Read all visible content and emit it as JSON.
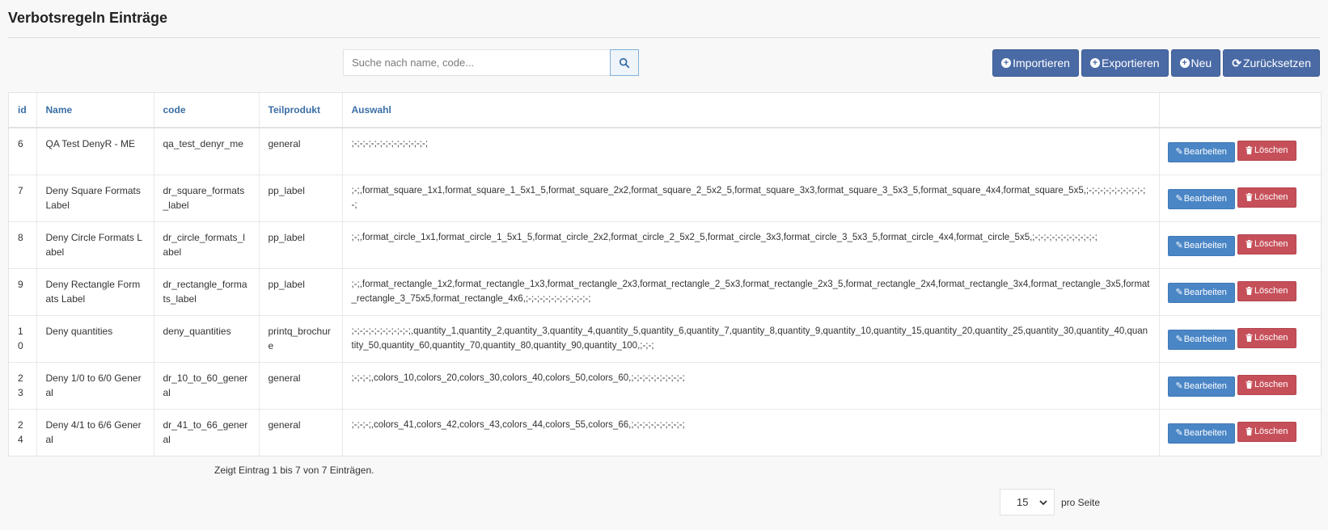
{
  "page": {
    "title": "Verbotsregeln Einträge"
  },
  "search": {
    "placeholder": "Suche nach name, code...",
    "value": ""
  },
  "toolbar": {
    "import_label": "Importieren",
    "export_label": "Exportieren",
    "new_label": "Neu",
    "reset_label": "Zurücksetzen"
  },
  "table": {
    "headers": {
      "id": "id",
      "name": "Name",
      "code": "code",
      "teilprodukt": "Teilprodukt",
      "auswahl": "Auswahl",
      "actions": ""
    },
    "edit_label": "Bearbeiten",
    "delete_label": "Löschen",
    "rows": [
      {
        "id": "6",
        "name": "QA Test DenyR - ME",
        "code": "qa_test_denyr_me",
        "teilprodukt": "general",
        "auswahl": ";-;-;-;-;-;-;-;-;-;-;-;-;-;"
      },
      {
        "id": "7",
        "name": "Deny Square Formats Label",
        "code": "dr_square_formats_label",
        "teilprodukt": "pp_label",
        "auswahl": ";-;,format_square_1x1,format_square_1_5x1_5,format_square_2x2,format_square_2_5x2_5,format_square_3x3,format_square_3_5x3_5,format_square_4x4,format_square_5x5,;-;-;-;-;-;-;-;-;-;-;-;"
      },
      {
        "id": "8",
        "name": "Deny Circle Formats Label",
        "code": "dr_circle_formats_label",
        "teilprodukt": "pp_label",
        "auswahl": ";-;,format_circle_1x1,format_circle_1_5x1_5,format_circle_2x2,format_circle_2_5x2_5,format_circle_3x3,format_circle_3_5x3_5,format_circle_4x4,format_circle_5x5,;-;-;-;-;-;-;-;-;-;-;-;"
      },
      {
        "id": "9",
        "name": "Deny Rectangle Formats Label",
        "code": "dr_rectangle_formats_label",
        "teilprodukt": "pp_label",
        "auswahl": ";-;,format_rectangle_1x2,format_rectangle_1x3,format_rectangle_2x3,format_rectangle_2_5x3,format_rectangle_2x3_5,format_rectangle_2x4,format_rectangle_3x4,format_rectangle_3x5,format_rectangle_3_75x5,format_rectangle_4x6,;-;-;-;-;-;-;-;-;-;-;-;"
      },
      {
        "id": "10",
        "name": "Deny quantities",
        "code": "deny_quantities",
        "teilprodukt": "printq_brochure",
        "auswahl": ";-;-;-;-;-;-;-;-;-;-;,quantity_1,quantity_2,quantity_3,quantity_4,quantity_5,quantity_6,quantity_7,quantity_8,quantity_9,quantity_10,quantity_15,quantity_20,quantity_25,quantity_30,quantity_40,quantity_50,quantity_60,quantity_70,quantity_80,quantity_90,quantity_100,;-;-;"
      },
      {
        "id": "23",
        "name": "Deny 1/0 to 6/0 General",
        "code": "dr_10_to_60_general",
        "teilprodukt": "general",
        "auswahl": ";-;-;-;,colors_10,colors_20,colors_30,colors_40,colors_50,colors_60,;-;-;-;-;-;-;-;-;-;"
      },
      {
        "id": "24",
        "name": "Deny 4/1 to 6/6 General",
        "code": "dr_41_to_66_general",
        "teilprodukt": "general",
        "auswahl": ";-;-;-;,colors_41,colors_42,colors_43,colors_44,colors_55,colors_66,;-;-;-;-;-;-;-;-;-;"
      }
    ]
  },
  "footer": {
    "info": "Zeigt Eintrag 1 bis 7 von 7 Einträgen.",
    "per_page_value": "15",
    "per_page_label": "pro Seite"
  },
  "colors": {
    "primary": "#4a6aa5",
    "edit": "#4a86c6",
    "delete": "#c6505a",
    "header_text": "#3a6ea5"
  }
}
